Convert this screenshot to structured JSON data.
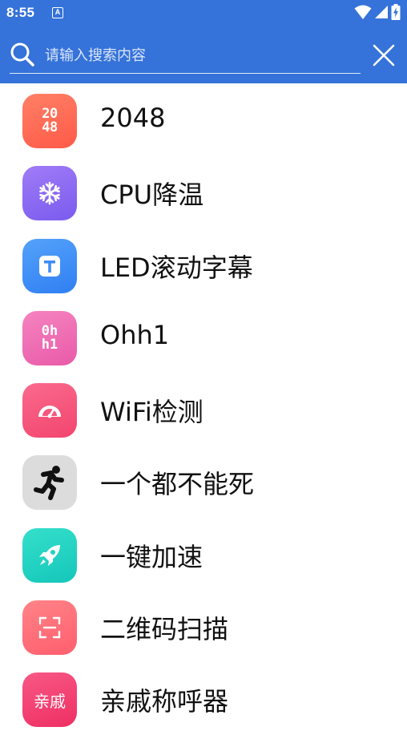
{
  "status_bar": {
    "time": "8:55",
    "notification_icon": "a-notification-icon",
    "wifi_icon": "wifi-icon",
    "signal_icon": "signal-icon",
    "battery_icon": "battery-charging-icon"
  },
  "search": {
    "placeholder": "请输入搜索内容",
    "value": "",
    "search_icon": "search-icon",
    "close_icon": "close-icon"
  },
  "colors": {
    "header_bg": "#3572D9",
    "text": "#111111"
  },
  "apps": [
    {
      "name": "2048",
      "icon": "2048-icon",
      "icon_label_line1": "20",
      "icon_label_line2": "48",
      "icon_color": "#FF6B57"
    },
    {
      "name": "CPU降温",
      "icon": "snowflake-icon",
      "icon_color": "#8E6BF2"
    },
    {
      "name": "LED滚动字幕",
      "icon": "text-t-icon",
      "icon_color": "#3E8EF7"
    },
    {
      "name": "Ohh1",
      "icon": "ohh1-icon",
      "icon_label_line1": "0h",
      "icon_label_line2": "h1",
      "icon_color": "#EE6FB5"
    },
    {
      "name": "WiFi检测",
      "icon": "speedometer-icon",
      "icon_color": "#F5577D"
    },
    {
      "name": "一个都不能死",
      "icon": "running-man-icon",
      "icon_color": "#DCDCDC"
    },
    {
      "name": "一键加速",
      "icon": "rocket-icon",
      "icon_color": "#22D2C0"
    },
    {
      "name": "二维码扫描",
      "icon": "scan-frame-icon",
      "icon_color": "#FF6E7A"
    },
    {
      "name": "亲戚称呼器",
      "icon": "qinqi-icon",
      "icon_label": "亲戚",
      "icon_color": "#F43D6F"
    }
  ]
}
